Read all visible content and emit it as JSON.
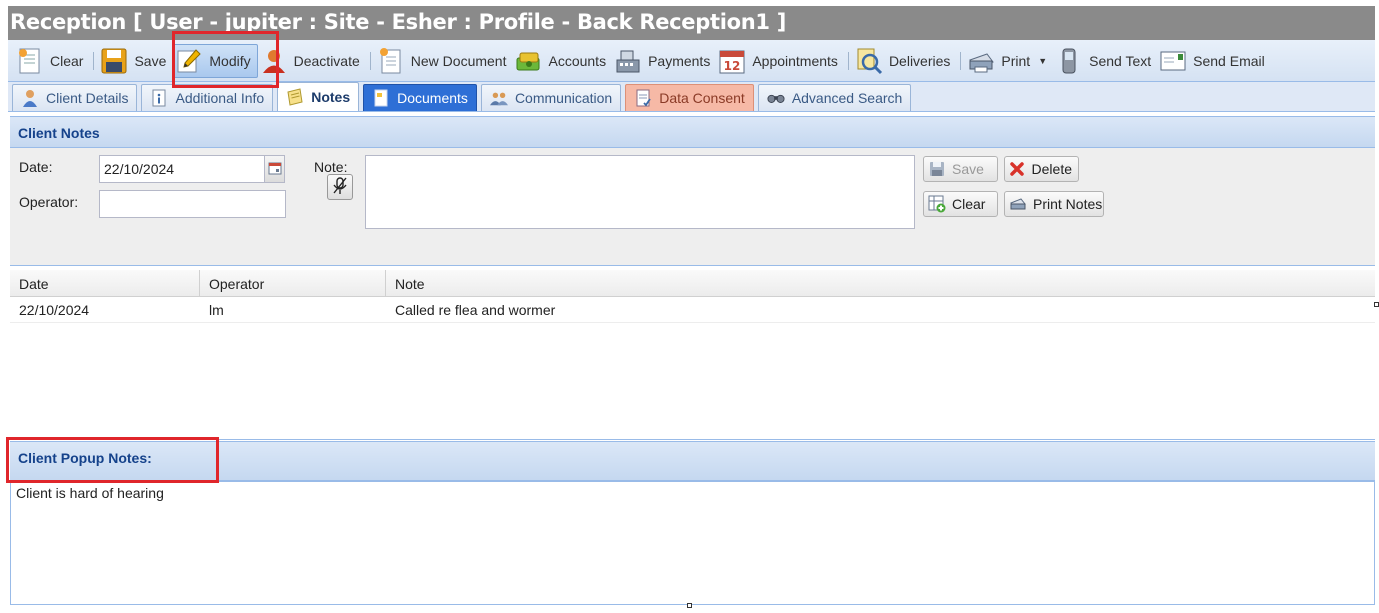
{
  "title": "Reception [ User - jupiter : Site - Esher : Profile - Back Reception1 ]",
  "toolbar": {
    "clear": "Clear",
    "save": "Save",
    "modify": "Modify",
    "deactivate": "Deactivate",
    "new_document": "New Document",
    "accounts": "Accounts",
    "payments": "Payments",
    "appointments": "Appointments",
    "deliveries": "Deliveries",
    "print": "Print",
    "send_text": "Send Text",
    "send_email": "Send Email"
  },
  "tabs": {
    "client_details": "Client Details",
    "additional_info": "Additional Info",
    "notes": "Notes",
    "documents": "Documents",
    "communication": "Communication",
    "data_consent": "Data Consent",
    "advanced_search": "Advanced Search"
  },
  "client_notes": {
    "header": "Client Notes",
    "date_label": "Date:",
    "date_value": "22/10/2024",
    "operator_label": "Operator:",
    "operator_value": "",
    "note_label": "Note:",
    "save_label": "Save",
    "delete_label": "Delete",
    "clear_label": "Clear",
    "print_notes_label": "Print Notes"
  },
  "grid": {
    "columns": [
      "Date",
      "Operator",
      "Note"
    ],
    "rows": [
      [
        "22/10/2024",
        "lm",
        "Called re flea and wormer"
      ]
    ]
  },
  "popup_notes": {
    "header": "Client Popup Notes:",
    "text": "Client is hard of hearing"
  },
  "colors": {
    "title_bar": "#8a8a8a",
    "highlight": "#e0262b",
    "documents_tab": "#2e6fd6",
    "data_consent_tab": "#f6b9a6",
    "header_text": "#15428b"
  }
}
